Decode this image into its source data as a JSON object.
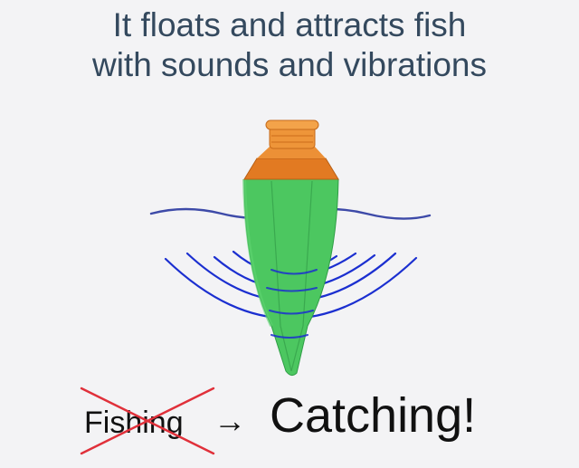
{
  "headline": {
    "line1": "It floats and attracts fish",
    "line2": "with sounds and vibrations"
  },
  "tagline": {
    "old_word": "Fishing",
    "arrow": "→",
    "new_word": "Catching!"
  },
  "colors": {
    "background": "#f3f3f5",
    "headline_text": "#34495e",
    "float_body": "#4cc760",
    "float_cap": "#e8892b",
    "water_line": "#3d4aa8",
    "sound_waves": "#1b2fd0",
    "strike": "#e0303a"
  }
}
